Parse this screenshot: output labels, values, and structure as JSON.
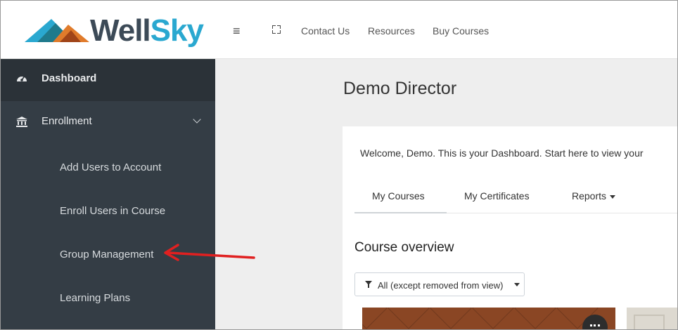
{
  "brand": {
    "name_part1": "Well",
    "name_part2": "Sky",
    "colors": {
      "dark": "#3c4a57",
      "accent": "#2aa8d0",
      "orange": "#e07b2b",
      "teal": "#1f7a8c"
    }
  },
  "topbar": {
    "menu_icon": "hamburger-icon",
    "fullscreen_icon": "fullscreen-icon",
    "links": [
      "Contact Us",
      "Resources",
      "Buy Courses"
    ]
  },
  "sidebar": {
    "items": [
      {
        "label": "Dashboard",
        "icon": "dashboard-icon",
        "active": true
      },
      {
        "label": "Enrollment",
        "icon": "bank-icon",
        "expanded": true
      }
    ],
    "sub_items": [
      "Add Users to Account",
      "Enroll Users in Course",
      "Group Management",
      "Learning Plans"
    ]
  },
  "main": {
    "title": "Demo Director",
    "welcome": "Welcome, Demo. This is your Dashboard. Start here to view your",
    "tabs": [
      "My Courses",
      "My Certificates",
      "Reports"
    ],
    "section_title": "Course overview",
    "filter": {
      "label": "All (except removed from view)",
      "icon": "filter-icon"
    }
  },
  "annotation": {
    "arrow_color": "#e02020"
  }
}
